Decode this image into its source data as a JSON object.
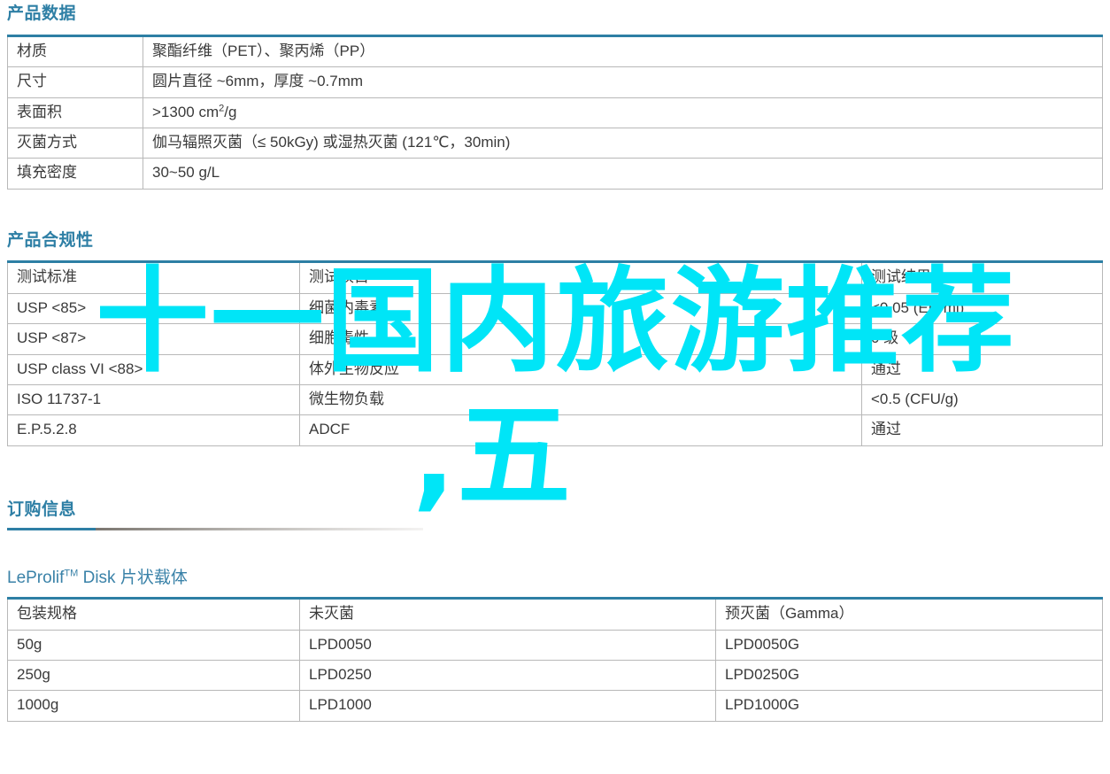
{
  "sections": {
    "product_data": {
      "heading": "产品数据",
      "rows": [
        {
          "label": "材质",
          "value": "聚酯纤维（PET）、聚丙烯（PP）"
        },
        {
          "label": "尺寸",
          "value": "圆片直径 ~6mm，厚度 ~0.7mm"
        },
        {
          "label": "表面积",
          "value_prefix": ">1300 cm",
          "value_sup": "2",
          "value_suffix": "/g"
        },
        {
          "label": "灭菌方式",
          "value": "伽马辐照灭菌（≤ 50kGy) 或湿热灭菌 (121℃，30min)"
        },
        {
          "label": "填充密度",
          "value": "30~50 g/L"
        }
      ]
    },
    "compliance": {
      "heading": "产品合规性",
      "headers": [
        "测试标准",
        "测试项目",
        "测试结果"
      ],
      "rows": [
        {
          "standard": "USP <85>",
          "item": "细菌内毒素",
          "result": "<0.05 (EU/ml)"
        },
        {
          "standard": "USP <87>",
          "item": "细胞毒性",
          "result": "0 级"
        },
        {
          "standard": "USP class VI <88>",
          "item": "体外生物反应",
          "result": "通过"
        },
        {
          "standard": "ISO 11737-1",
          "item": "微生物负载",
          "result": "<0.5 (CFU/g)"
        },
        {
          "standard": "E.P.5.2.8",
          "item": "ADCF",
          "result": "通过"
        }
      ]
    },
    "ordering": {
      "heading": "订购信息",
      "product_title_main": "LeProlif",
      "product_title_tm": "TM",
      "product_title_rest": " Disk 片状载体",
      "headers": [
        "包装规格",
        "未灭菌",
        "预灭菌（Gamma）"
      ],
      "rows": [
        {
          "size": "50g",
          "unsterile": "LPD0050",
          "sterile": "LPD0050G"
        },
        {
          "size": "250g",
          "unsterile": "LPD0250",
          "sterile": "LPD0250G"
        },
        {
          "size": "1000g",
          "unsterile": "LPD1000",
          "sterile": "LPD1000G"
        }
      ]
    }
  },
  "overlay": {
    "line1": "十一国内旅游推荐",
    "line2": ",五",
    "color": "#00e5f7"
  },
  "theme": {
    "heading_color": "#2e7fa5",
    "table_top_border": "#2d7fa4",
    "label_color": "#4a7f9f",
    "cell_color": "#3a3a3a"
  }
}
